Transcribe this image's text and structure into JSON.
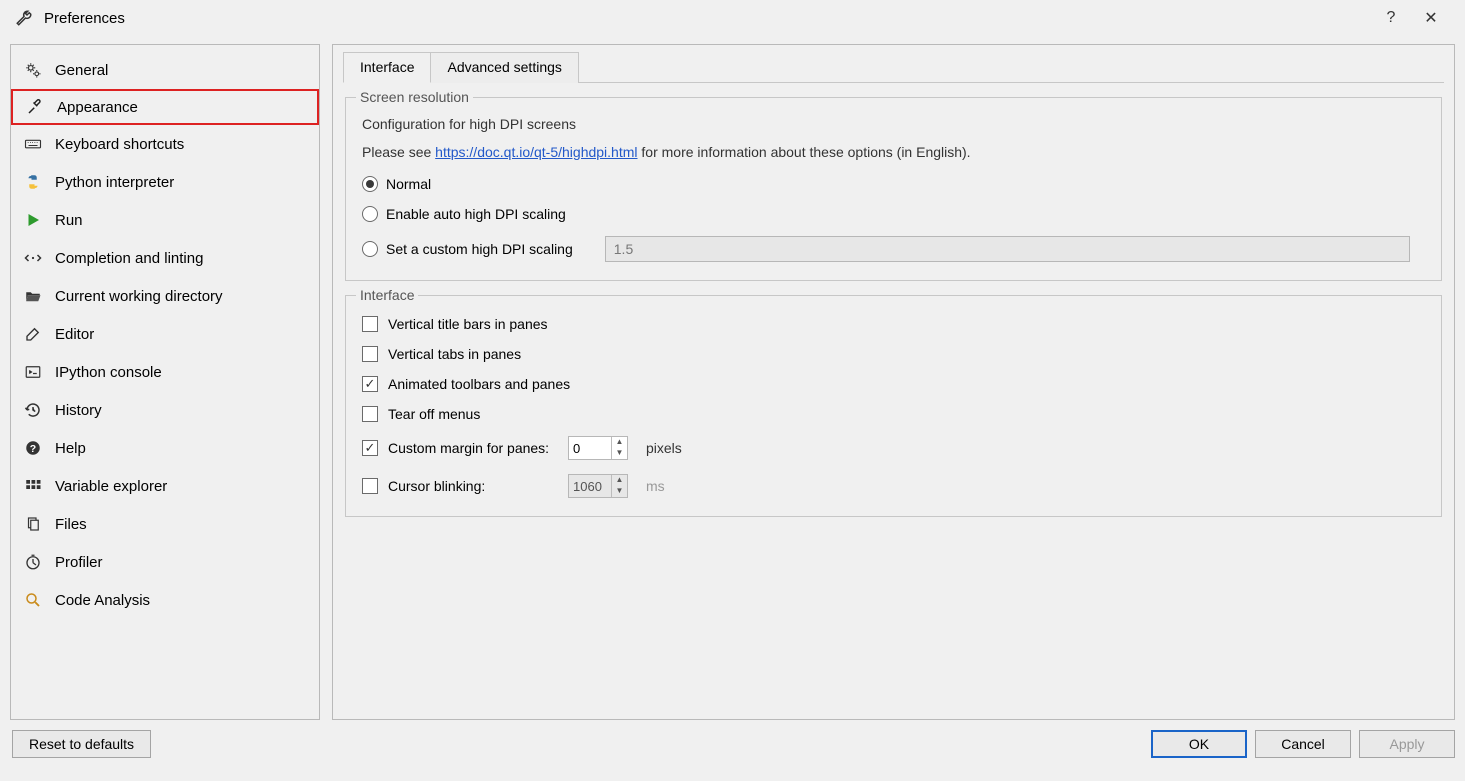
{
  "window": {
    "title": "Preferences"
  },
  "sidebar": {
    "items": [
      {
        "label": "General"
      },
      {
        "label": "Appearance"
      },
      {
        "label": "Keyboard shortcuts"
      },
      {
        "label": "Python interpreter"
      },
      {
        "label": "Run"
      },
      {
        "label": "Completion and linting"
      },
      {
        "label": "Current working directory"
      },
      {
        "label": "Editor"
      },
      {
        "label": "IPython console"
      },
      {
        "label": "History"
      },
      {
        "label": "Help"
      },
      {
        "label": "Variable explorer"
      },
      {
        "label": "Files"
      },
      {
        "label": "Profiler"
      },
      {
        "label": "Code Analysis"
      }
    ]
  },
  "tabs": {
    "interface": "Interface",
    "advanced": "Advanced settings"
  },
  "screen_res": {
    "legend": "Screen resolution",
    "subtitle": "Configuration for high DPI screens",
    "info_prefix": "Please see ",
    "info_link": "https://doc.qt.io/qt-5/highdpi.html",
    "info_suffix": " for more information about these options (in English).",
    "radio_normal": "Normal",
    "radio_auto": "Enable auto high DPI scaling",
    "radio_custom": "Set a custom high DPI scaling",
    "custom_value": "1.5"
  },
  "interface": {
    "legend": "Interface",
    "vertical_title": "Vertical title bars in panes",
    "vertical_tabs": "Vertical tabs in panes",
    "animated": "Animated toolbars and panes",
    "tearoff": "Tear off menus",
    "custom_margin": "Custom margin for panes:",
    "custom_margin_value": "0",
    "custom_margin_unit": "pixels",
    "cursor_blinking": "Cursor blinking:",
    "cursor_blinking_value": "1060",
    "cursor_blinking_unit": "ms"
  },
  "buttons": {
    "reset": "Reset to defaults",
    "ok": "OK",
    "cancel": "Cancel",
    "apply": "Apply"
  }
}
